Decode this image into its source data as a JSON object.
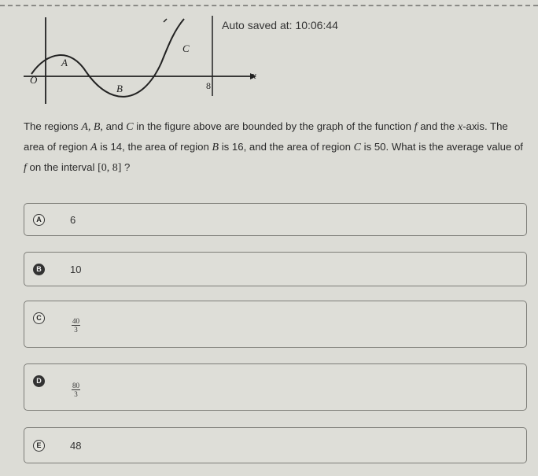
{
  "autosave": {
    "label": "Auto saved at:",
    "time": "10:06:44"
  },
  "figure": {
    "region_a": "A",
    "region_b": "B",
    "region_c": "C",
    "origin_label": "O",
    "x_tick": "8",
    "x_axis_label": "x"
  },
  "question": {
    "part1": "The regions ",
    "region_list": "A, B,",
    "part2": " and ",
    "region_c": "C",
    "part3": " in the figure above are bounded by the graph of the function ",
    "func": "f",
    "part4": " and the ",
    "axis": "x",
    "part5": "-axis. The area of region ",
    "region_a": "A",
    "part6": " is 14, the area of region ",
    "region_b": "B",
    "part7": " is 16, and the area of region ",
    "region_c2": "C",
    "part8": " is 50. What is the average value of ",
    "func2": "f",
    "part9": " on the interval ",
    "interval": "[0, 8]",
    "part10": " ?"
  },
  "choices": [
    {
      "letter": "A",
      "text": "6"
    },
    {
      "letter": "B",
      "text": "10"
    },
    {
      "letter": "C",
      "numerator": "40",
      "denominator": "3"
    },
    {
      "letter": "D",
      "numerator": "80",
      "denominator": "3"
    },
    {
      "letter": "E",
      "text": "48"
    }
  ]
}
